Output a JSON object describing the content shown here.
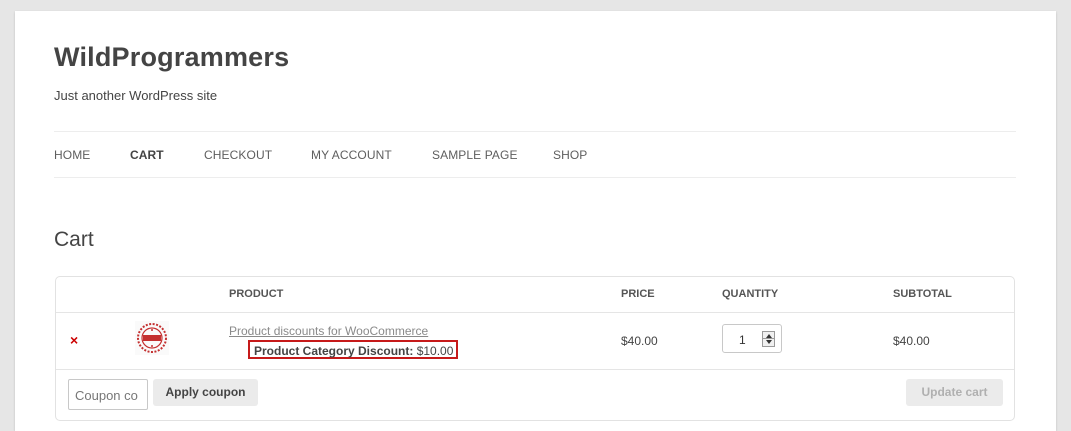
{
  "header": {
    "site_title": "WildProgrammers",
    "tagline": "Just another WordPress site"
  },
  "nav": {
    "items": [
      {
        "label": "HOME",
        "current": false
      },
      {
        "label": "CART",
        "current": true
      },
      {
        "label": "CHECKOUT",
        "current": false
      },
      {
        "label": "MY ACCOUNT",
        "current": false
      },
      {
        "label": "SAMPLE PAGE",
        "current": false
      },
      {
        "label": "SHOP",
        "current": false
      }
    ]
  },
  "main": {
    "page_title": "Cart"
  },
  "cart": {
    "columns": {
      "product": "PRODUCT",
      "price": "PRICE",
      "quantity": "QUANTITY",
      "subtotal": "SUBTOTAL"
    },
    "items": [
      {
        "remove_symbol": "×",
        "thumbnail_icon": "stamp-badge-icon",
        "name": "Product discounts for WooCommerce",
        "discount_label": "Product Category Discount:",
        "discount_value": "$10.00",
        "price": "$40.00",
        "quantity": "1",
        "subtotal": "$40.00"
      }
    ],
    "coupon": {
      "placeholder": "Coupon co",
      "apply_label": "Apply coupon"
    },
    "update_label": "Update cart"
  },
  "colors": {
    "accent_remove": "#cc0000",
    "highlight_border": "#c61a1a",
    "page_background": "#e6e6e6"
  }
}
